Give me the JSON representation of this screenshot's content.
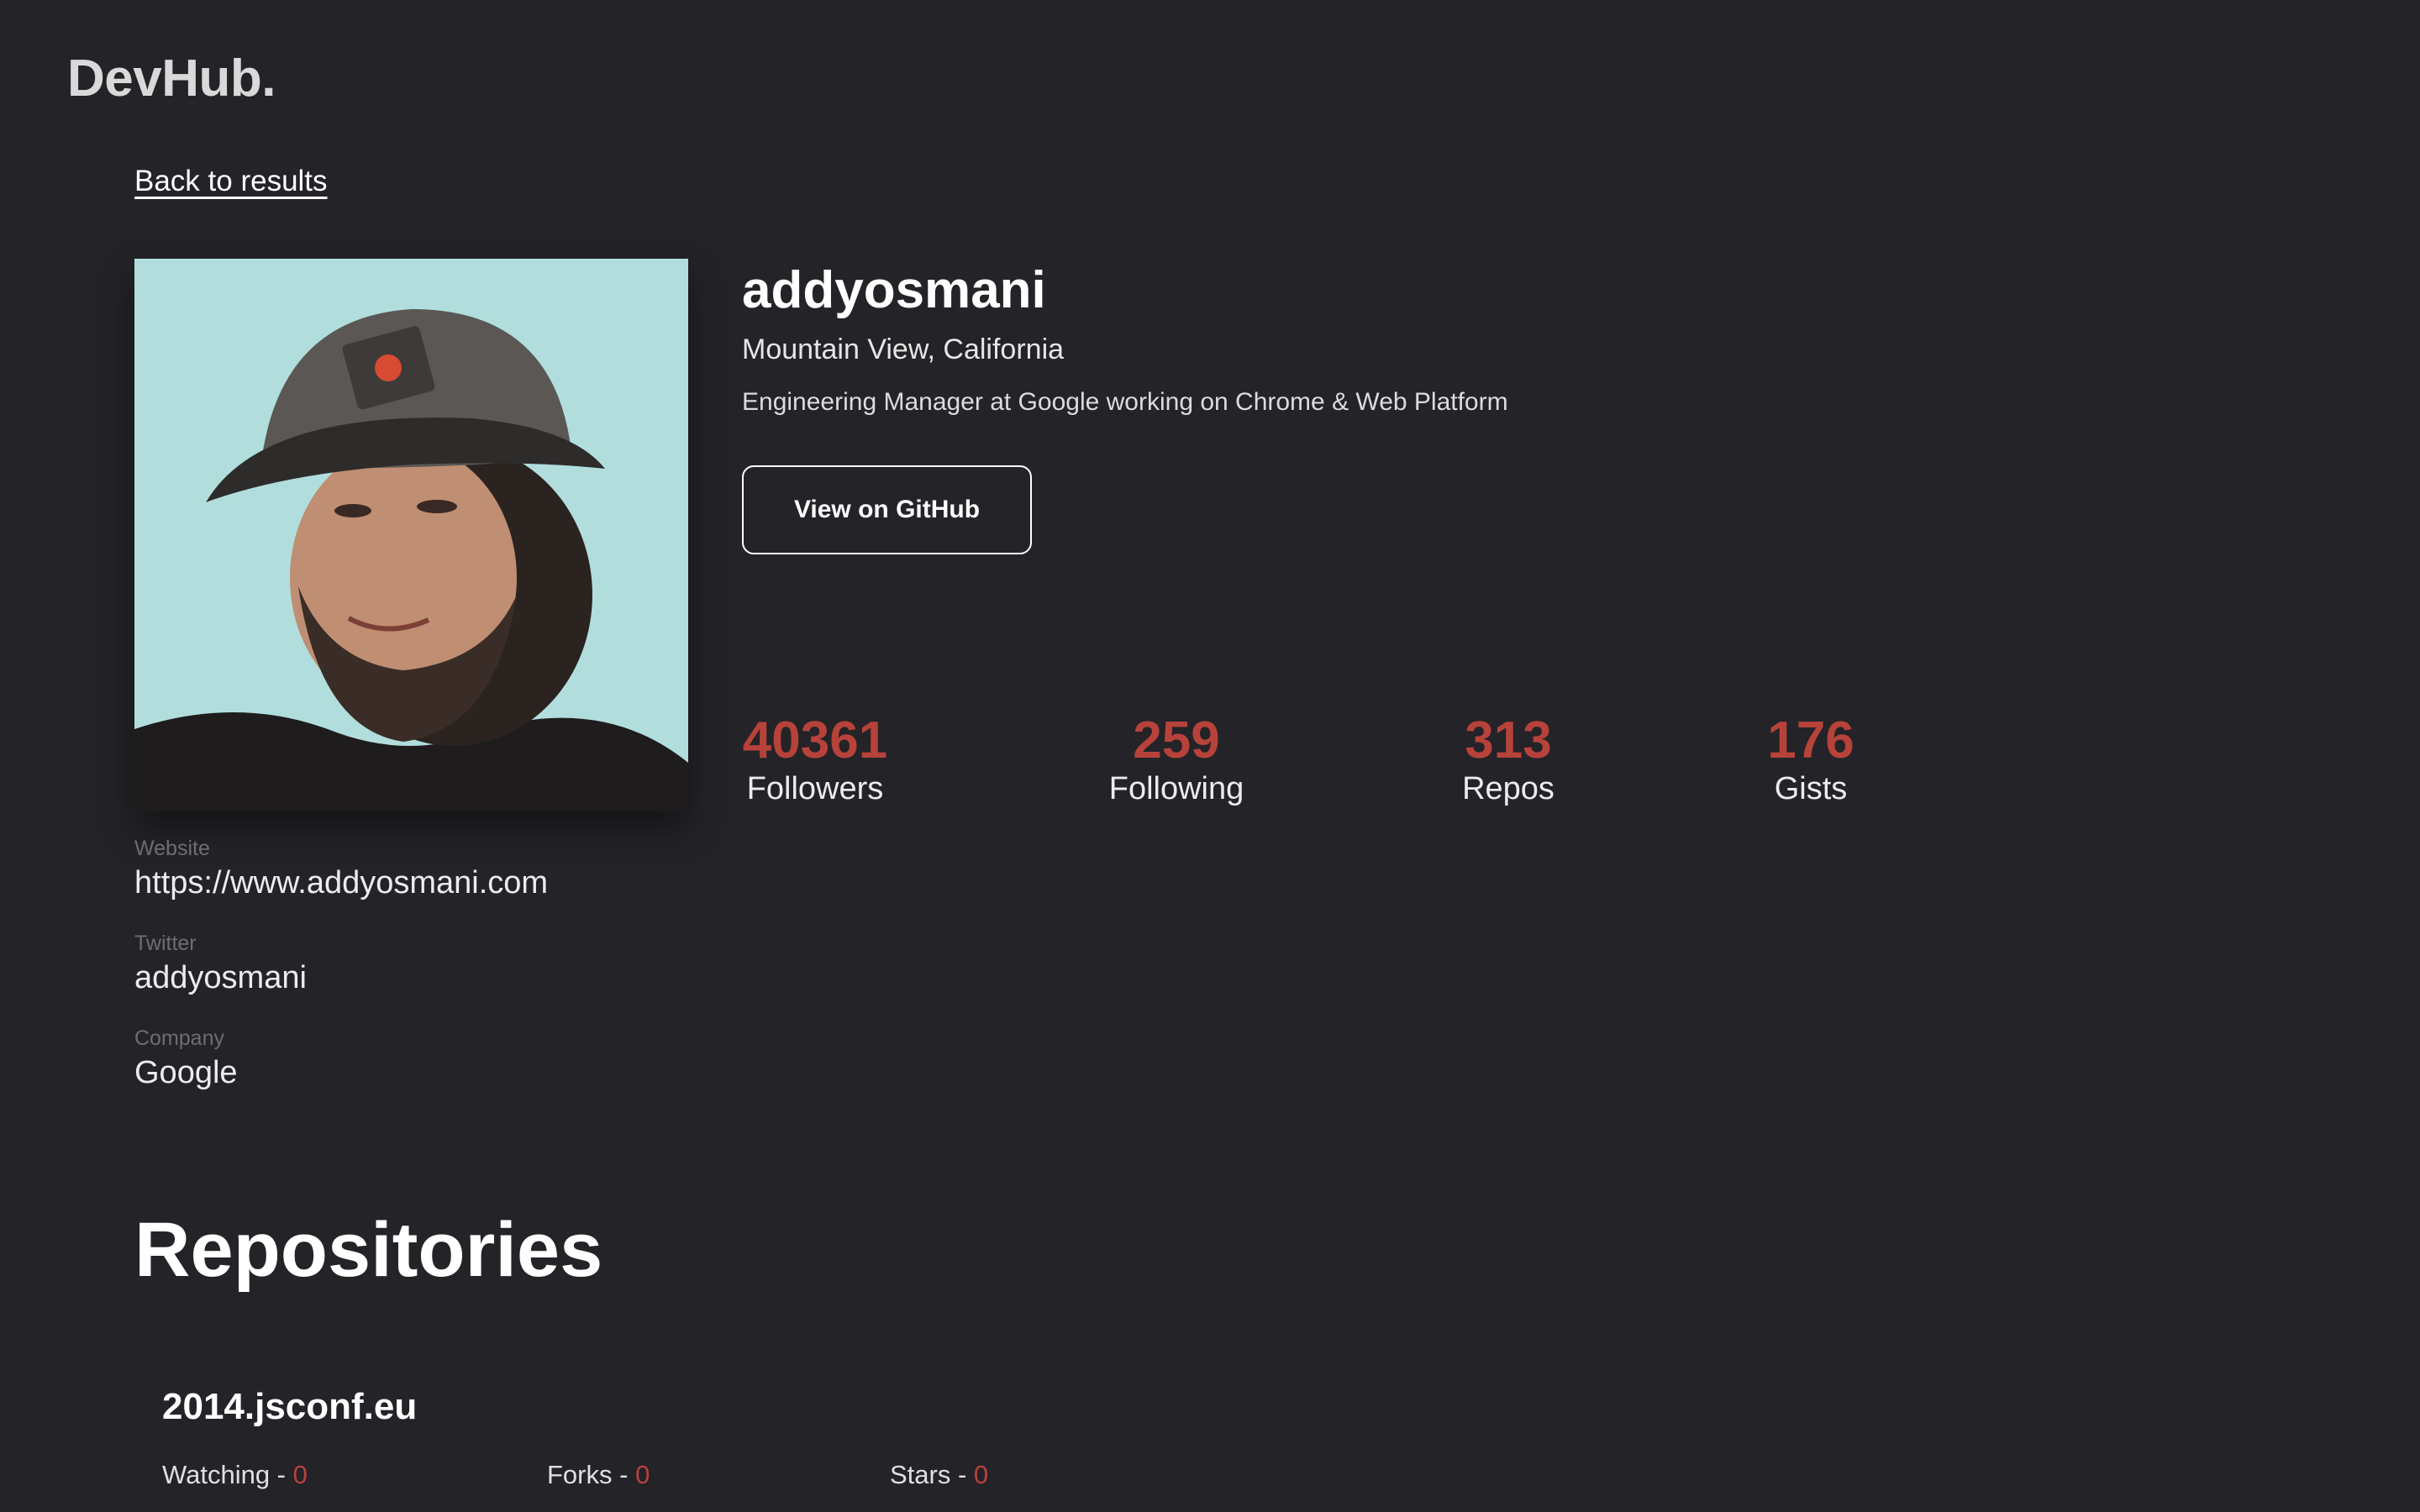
{
  "brand": {
    "logo_text": "DevHub."
  },
  "nav": {
    "back_label": "Back to results"
  },
  "profile": {
    "username": "addyosmani",
    "location": "Mountain View, California",
    "bio": "Engineering Manager at Google working on Chrome & Web Platform",
    "github_button_label": "View on GitHub",
    "avatar_bg_color": "#b1dedd",
    "details": [
      {
        "label": "Website",
        "value": "https://www.addyosmani.com"
      },
      {
        "label": "Twitter",
        "value": "addyosmani"
      },
      {
        "label": "Company",
        "value": "Google"
      }
    ]
  },
  "stats": [
    {
      "value": "40361",
      "label": "Followers"
    },
    {
      "value": "259",
      "label": "Following"
    },
    {
      "value": "313",
      "label": "Repos"
    },
    {
      "value": "176",
      "label": "Gists"
    }
  ],
  "accent_color": "#b7423a",
  "repositories": {
    "title": "Repositories",
    "items": [
      {
        "name": "2014.jsconf.eu",
        "watching_label": "Watching - ",
        "watching": "0",
        "forks_label": "Forks - ",
        "forks": "0",
        "stars_label": "Stars - ",
        "stars": "0"
      }
    ]
  }
}
